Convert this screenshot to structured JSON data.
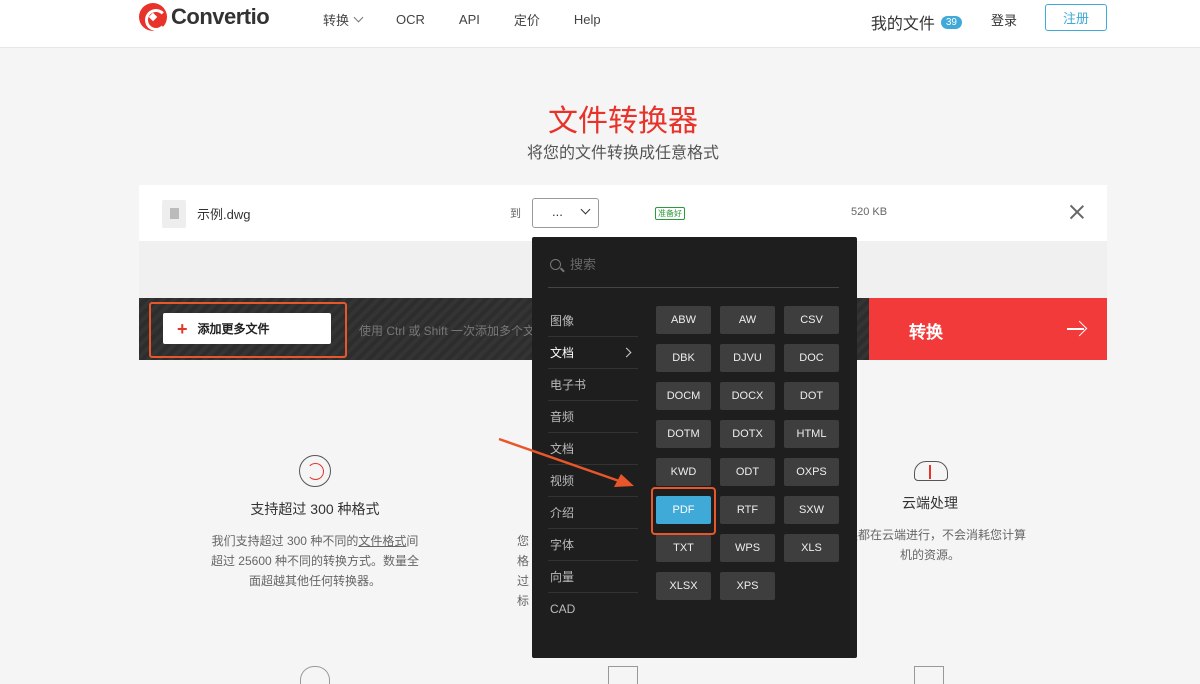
{
  "header": {
    "logo": "Convertio",
    "nav": [
      "转换",
      "OCR",
      "API",
      "定价",
      "Help"
    ],
    "my_files": "我的文件",
    "my_files_count": "39",
    "login": "登录",
    "register": "注册"
  },
  "hero": {
    "title": "文件转换器",
    "subtitle": "将您的文件转换成任意格式"
  },
  "file": {
    "name": "示例.dwg",
    "to_label": "到",
    "selected_format": "...",
    "status": "准备好",
    "size": "520 KB"
  },
  "actions": {
    "add_more": "添加更多文件",
    "hint": "使用 Ctrl 或 Shift 一次添加多个文",
    "convert": "转换"
  },
  "dropdown": {
    "search_placeholder": "搜索",
    "categories": [
      "图像",
      "文档",
      "电子书",
      "音频",
      "文档",
      "视频",
      "介绍",
      "字体",
      "向量",
      "CAD"
    ],
    "active_category": "文档",
    "formats": [
      "ABW",
      "AW",
      "CSV",
      "DBK",
      "DJVU",
      "DOC",
      "DOCM",
      "DOCX",
      "DOT",
      "DOTM",
      "DOTX",
      "HTML",
      "KWD",
      "ODT",
      "OXPS",
      "PDF",
      "RTF",
      "SXW",
      "TXT",
      "WPS",
      "XLS",
      "XLSX",
      "XPS"
    ],
    "selected_format": "PDF"
  },
  "features": {
    "f1_title": "支持超过 300 种格式",
    "f1_desc_a": "我们支持超过 300 种不同的",
    "f1_desc_link": "文件格式",
    "f1_desc_b": "间超过 25600 种不同的转换方式。数量全面超越其他任何转换器。",
    "f2_frag": [
      "您",
      "格",
      "过",
      "标"
    ],
    "f3_title": "云端处理",
    "f3_desc": "转换都在云端进行，不会消耗您计算机的资源。"
  },
  "colors": {
    "brand_red": "#e8332b",
    "accent_blue": "#3fa9d8",
    "annotation": "#e8572b"
  }
}
